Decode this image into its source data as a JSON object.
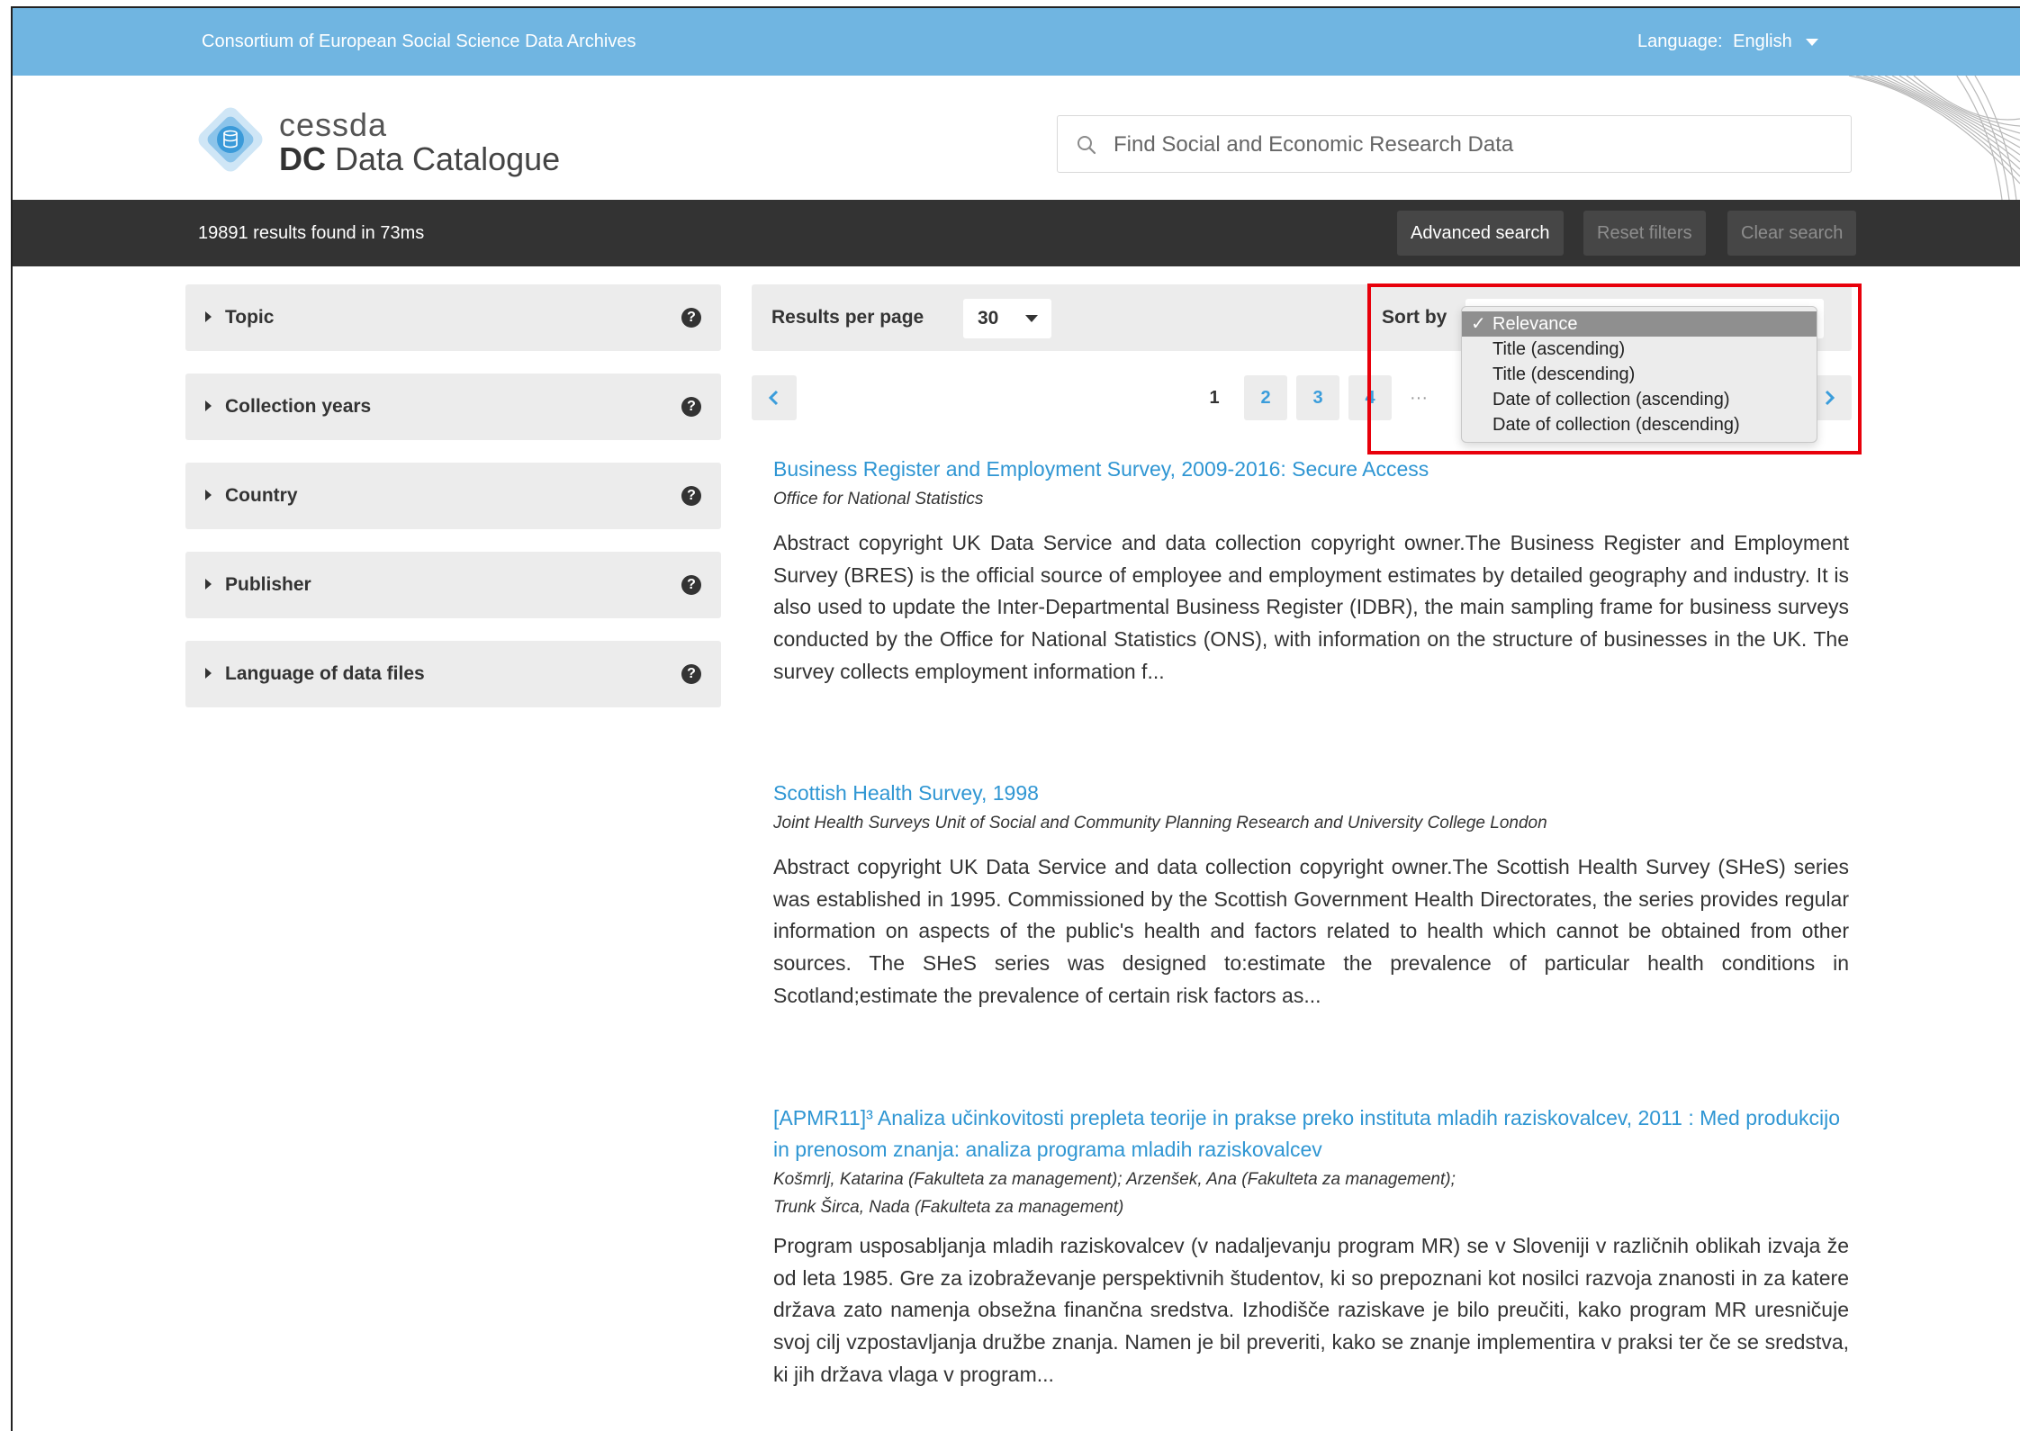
{
  "topbar": {
    "org_name": "Consortium of European Social Science Data Archives",
    "language_label": "Language:",
    "language_value": "English"
  },
  "logo": {
    "small": "cessda",
    "big_bold": "DC",
    "big_rest": " Data Catalogue"
  },
  "search": {
    "placeholder": "Find Social and Economic Research Data",
    "value": ""
  },
  "darkbar": {
    "results_text": "19891 results found in 73ms",
    "advanced_search": "Advanced search",
    "reset_filters": "Reset filters",
    "clear_search": "Clear search"
  },
  "facets": [
    {
      "label": "Topic"
    },
    {
      "label": "Collection years"
    },
    {
      "label": "Country"
    },
    {
      "label": "Publisher"
    },
    {
      "label": "Language of data files"
    }
  ],
  "toolbar": {
    "results_per_page_label": "Results per page",
    "results_per_page_value": "30",
    "sort_by_label": "Sort by",
    "sort_options": [
      "Relevance",
      "Title (ascending)",
      "Title (descending)",
      "Date of collection (ascending)",
      "Date of collection (descending)"
    ],
    "sort_selected": "Relevance",
    "check_mark": "✓"
  },
  "pagination": {
    "current": "1",
    "pages": [
      "2",
      "3",
      "4"
    ],
    "ellipsis": "···"
  },
  "results": [
    {
      "title": "Business Register and Employment Survey, 2009-2016: Secure Access",
      "publisher": "Office for National Statistics",
      "abstract": "Abstract copyright UK Data Service and data collection copyright owner.The Business Register and Employment Survey (BRES) is the official source of employee and employment estimates by detailed geography and industry. It is also used to update the Inter-Departmental Business Register (IDBR), the main sampling frame for business surveys conducted by the Office for National Statistics (ONS), with information on the structure of businesses in the UK. The survey collects employment information f..."
    },
    {
      "title": "Scottish Health Survey, 1998",
      "publisher": "Joint Health Surveys Unit of Social and Community Planning Research and University College London",
      "abstract": "Abstract copyright UK Data Service and data collection copyright owner.The Scottish Health Survey (SHeS) series was established in 1995. Commissioned by the Scottish Government Health Directorates, the series provides regular information on aspects of the public's health and factors related to health which cannot be obtained from other sources. The SHeS series was designed to:estimate the prevalence of particular health conditions in Scotland;estimate the prevalence of certain risk factors as..."
    },
    {
      "title": "[APMR11]³ Analiza učinkovitosti prepleta teorije in prakse preko instituta mladih raziskovalcev, 2011 : Med produkcijo in prenosom znanja: analiza programa mladih raziskovalcev",
      "publisher_line1": "Košmrlj, Katarina (Fakulteta za management); Arzenšek, Ana (Fakulteta za management);",
      "publisher_line2": "Trunk Širca, Nada (Fakulteta za management)",
      "abstract": "Program usposabljanja mladih raziskovalcev (v nadaljevanju program MR) se v Sloveniji v različnih oblikah izvaja že od leta 1985. Gre za izobraževanje perspektivnih študentov, ki so prepoznani kot nosilci razvoja znanosti in za katere država zato namenja obsežna finančna sredstva. Izhodišče raziskave je bilo preučiti, kako program MR uresničuje svoj cilj vzpostavljanja družbe znanja. Namen je bil preveriti, kako se znanje implementira v praksi ter če se sredstva, ki jih država vlaga v program..."
    }
  ]
}
